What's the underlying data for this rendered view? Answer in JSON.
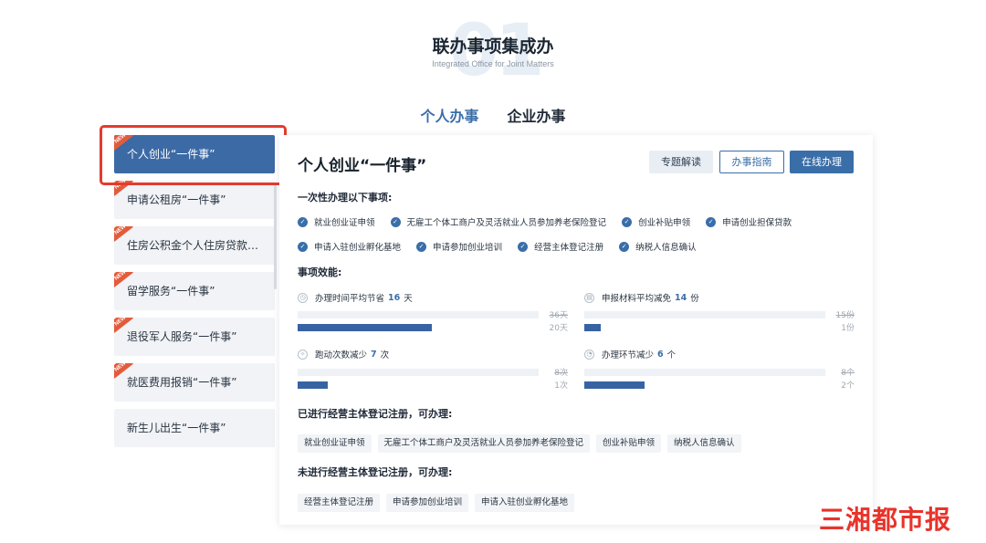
{
  "header": {
    "bg_number": "01",
    "title": "联办事项集成办",
    "subtitle": "Integrated Office for Joint Matters"
  },
  "tabs": [
    {
      "label": "个人办事",
      "active": true
    },
    {
      "label": "企业办事",
      "active": false
    }
  ],
  "sidebar": {
    "badge_text": "NEW",
    "items": [
      {
        "label": "个人创业“一件事”",
        "badge": true,
        "active": true
      },
      {
        "label": "申请公租房“一件事”",
        "badge": true,
        "active": false
      },
      {
        "label": "住房公积金个人住房贷款购房“一件事”",
        "badge": true,
        "active": false
      },
      {
        "label": "留学服务“一件事”",
        "badge": true,
        "active": false
      },
      {
        "label": "退役军人服务“一件事”",
        "badge": true,
        "active": false
      },
      {
        "label": "就医费用报销“一件事”",
        "badge": true,
        "active": false
      },
      {
        "label": "新生儿出生“一件事”",
        "badge": false,
        "active": false
      }
    ]
  },
  "card": {
    "title": "个人创业“一件事”",
    "buttons": {
      "read": "专题解读",
      "guide": "办事指南",
      "online": "在线办理"
    },
    "section_once": "一次性办理以下事项:",
    "check_row1": [
      "就业创业证申领",
      "无雇工个体工商户及灵活就业人员参加养老保险登记",
      "创业补贴申领",
      "申请创业担保贷款"
    ],
    "check_row2": [
      "申请入驻创业孵化基地",
      "申请参加创业培训",
      "经营主体登记注册",
      "纳税人信息确认"
    ],
    "section_effect": "事项效能:",
    "metrics": [
      {
        "prefix": "办理时间平均节省",
        "num": "16",
        "unit": "天",
        "before": "36天",
        "after": "20天",
        "ratio": 0.556
      },
      {
        "prefix": "申报材料平均减免",
        "num": "14",
        "unit": "份",
        "before": "15份",
        "after": "1份",
        "ratio": 0.067
      },
      {
        "prefix": "跑动次数减少",
        "num": "7",
        "unit": "次",
        "before": "8次",
        "after": "1次",
        "ratio": 0.125
      },
      {
        "prefix": "办理环节减少",
        "num": "6",
        "unit": "个",
        "before": "8个",
        "after": "2个",
        "ratio": 0.25
      }
    ],
    "section_registered": "已进行经营主体登记注册，可办理:",
    "tags_registered": [
      "就业创业证申领",
      "无雇工个体工商户及灵活就业人员参加养老保险登记",
      "创业补贴申领",
      "纳税人信息确认"
    ],
    "section_unregistered": "未进行经营主体登记注册，可办理:",
    "tags_unregistered": [
      "经营主体登记注册",
      "申请参加创业培训",
      "申请入驻创业孵化基地"
    ]
  },
  "watermark": "三湘都市报",
  "colors": {
    "accent": "#3a6ea8",
    "highlight": "#e53b2c",
    "badge": "#e35b3b"
  }
}
